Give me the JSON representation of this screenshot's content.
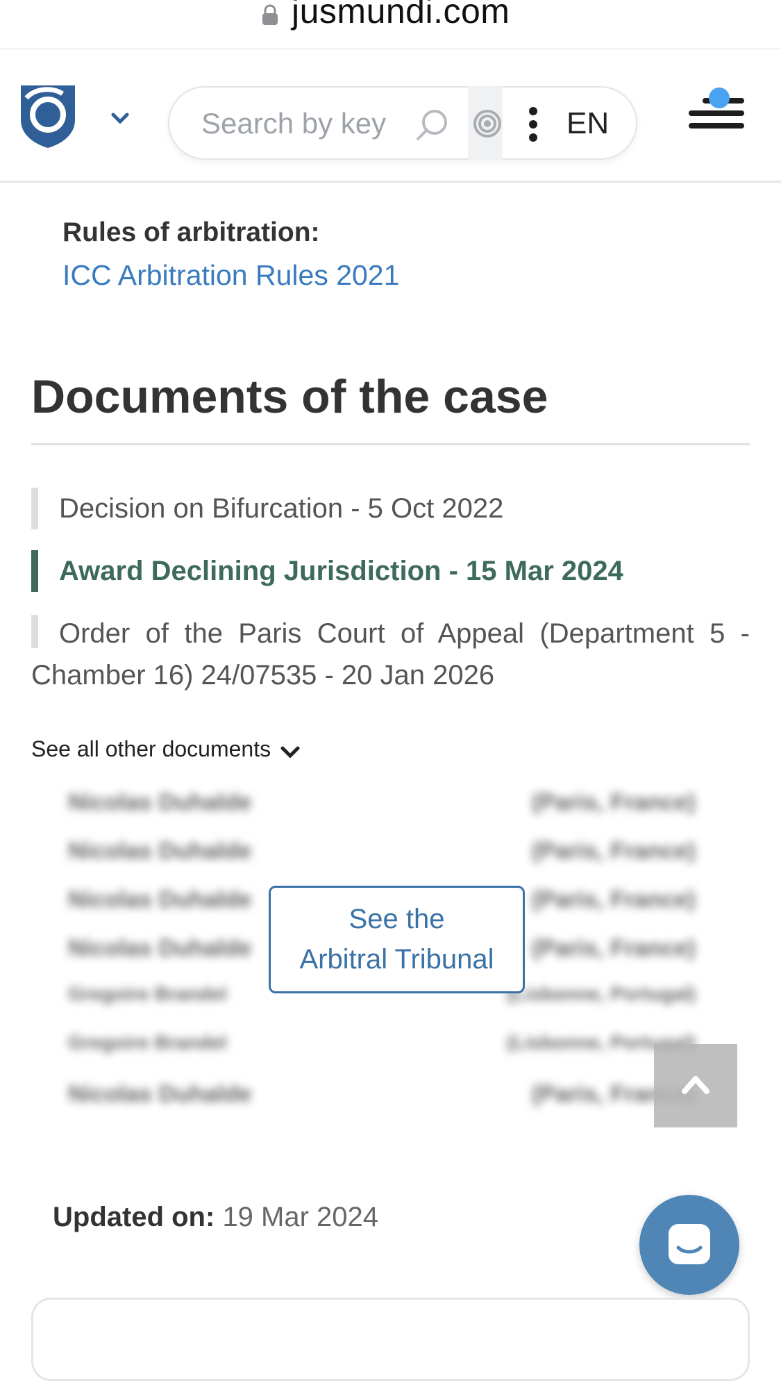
{
  "browser": {
    "url": "jusmundi.com"
  },
  "header": {
    "search_placeholder": "Search by key",
    "language": "EN"
  },
  "case": {
    "rules_label": "Rules of arbitration:",
    "rules_value": "ICC Arbitration Rules 2021"
  },
  "documents": {
    "title": "Documents of the case",
    "items": [
      {
        "label": "Decision on Bifurcation - 5 Oct 2022",
        "active": false
      },
      {
        "label": "Award Declining Jurisdiction - 15 Mar 2024",
        "active": true
      },
      {
        "label": "Order of the Paris Court of Appeal (Department 5 - Chamber 16) 24/07535 - 20 Jan 2026",
        "active": false
      }
    ],
    "see_all": "See all other documents"
  },
  "tribunal": {
    "button_line1": "See the",
    "button_line2": "Arbitral Tribunal",
    "rows": [
      {
        "name": "Nicolas Duhalde",
        "place": "(Paris, France)"
      },
      {
        "name": "Nicolas Duhalde",
        "place": "(Paris, France)"
      },
      {
        "name": "Nicolas Duhalde",
        "place": "(Paris, France)"
      },
      {
        "name": "Nicolas Duhalde",
        "place": "(Paris, France)"
      },
      {
        "name": "Gregoire Brandel",
        "place": "(Lisbonne, Portugal)"
      },
      {
        "name": "Gregoire Brandel",
        "place": "(Lisbonne, Portugal)"
      },
      {
        "name": "Nicolas Duhalde",
        "place": "(Paris, France)"
      }
    ]
  },
  "updated": {
    "label": "Updated on:",
    "value": "19 Mar 2024"
  },
  "colors": {
    "link": "#3a7bbf",
    "active_document": "#3e6b59",
    "button_border": "#3a72a6",
    "chat_button": "#4f86b6",
    "notification_dot": "#4aa3f0"
  },
  "icons": {
    "lock": "lock-icon",
    "logo": "jus-mundi-logo",
    "search": "search-icon",
    "target": "target-icon",
    "more": "more-vertical-icon",
    "menu": "menu-icon",
    "scroll_top": "chevron-up-icon",
    "chat": "chat-icon"
  }
}
